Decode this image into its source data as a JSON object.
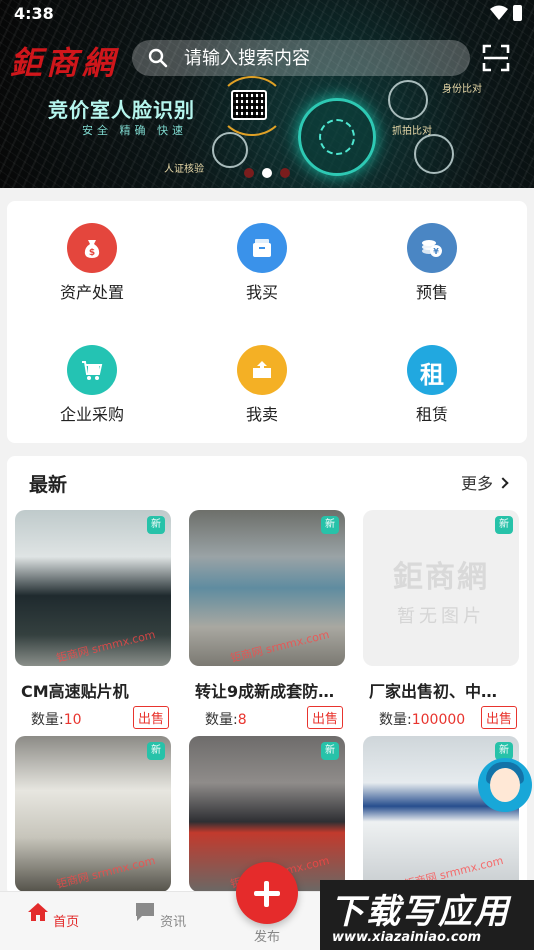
{
  "status_bar": {
    "time": "4:38"
  },
  "banner": {
    "logo": "鉅商網",
    "search_placeholder": "请输入搜索内容",
    "title": "竞价室人脸识别",
    "subtitle": "安全 精确 快速",
    "labels": [
      "身份比对",
      "抓拍比对",
      "人证核验"
    ],
    "dots": 3,
    "active_dot": 2
  },
  "categories": [
    {
      "label": "资产处置",
      "icon": "money-bag-icon",
      "color": "#e4463d"
    },
    {
      "label": "我买",
      "icon": "box-icon",
      "color": "#3a92ea"
    },
    {
      "label": "预售",
      "icon": "coins-icon",
      "color": "#4a86c4"
    },
    {
      "label": "企业采购",
      "icon": "cart-icon",
      "color": "#24c3b3"
    },
    {
      "label": "我卖",
      "icon": "sell-box-icon",
      "color": "#f4b025"
    },
    {
      "label": "租赁",
      "icon": "rent-icon",
      "glyph": "租",
      "color": "#21a8e0"
    }
  ],
  "latest": {
    "title": "最新",
    "more": "更多",
    "qty_label": "数量:",
    "new_badge": "新",
    "sale_badge": "出售",
    "watermark": "钜商网 srmmx.com",
    "no_image_logo": "鉅商網",
    "no_image_text": "暂无图片",
    "products": [
      {
        "name": "CM高速贴片机",
        "qty": "10"
      },
      {
        "name": "转让9成新成套防…",
        "qty": "8"
      },
      {
        "name": "厂家出售初、中…",
        "qty": "100000"
      },
      {
        "name": "",
        "qty": ""
      },
      {
        "name": "",
        "qty": ""
      },
      {
        "name": "",
        "qty": ""
      }
    ]
  },
  "nav": {
    "home": "首页",
    "news": "资讯",
    "publish": "发布"
  },
  "watermark_site": {
    "big": "下载写应用",
    "url": "www.xiazainiao.com"
  }
}
